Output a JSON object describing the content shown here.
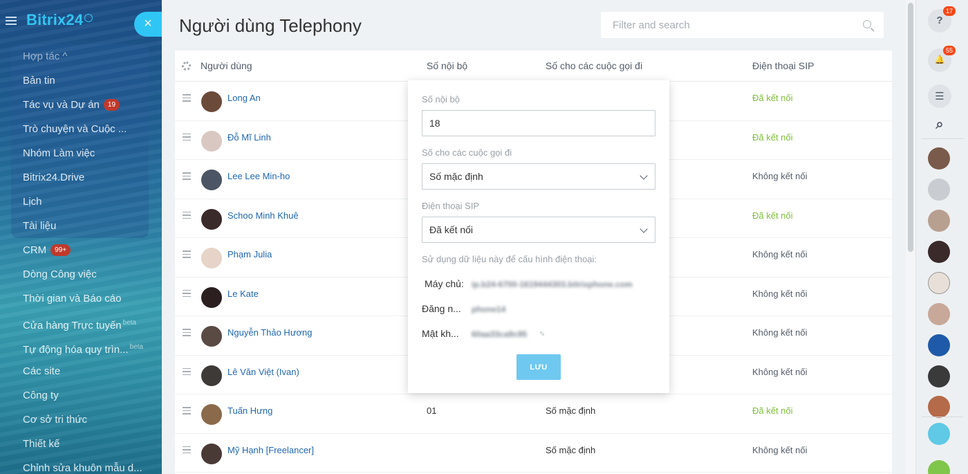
{
  "app": {
    "logo_text": "Bitrix24",
    "collapse_label": "×"
  },
  "sidebar": {
    "items": [
      {
        "label": "Hợp tác ^",
        "badge": "",
        "beta": ""
      },
      {
        "label": "Bản tin",
        "badge": "",
        "beta": ""
      },
      {
        "label": "Tác vụ và Dự án",
        "badge": "19",
        "beta": ""
      },
      {
        "label": "Trò chuyện và Cuộc ...",
        "badge": "",
        "beta": ""
      },
      {
        "label": "Nhóm Làm việc",
        "badge": "",
        "beta": ""
      },
      {
        "label": "Bitrix24.Drive",
        "badge": "",
        "beta": ""
      },
      {
        "label": "Lịch",
        "badge": "",
        "beta": ""
      },
      {
        "label": "Tài liệu",
        "badge": "",
        "beta": ""
      },
      {
        "label": "CRM",
        "badge": "99+",
        "beta": ""
      },
      {
        "label": "Dòng Công việc",
        "badge": "",
        "beta": ""
      },
      {
        "label": "Thời gian và Báo cáo",
        "badge": "",
        "beta": ""
      },
      {
        "label": "Cửa hàng Trực tuyến",
        "badge": "",
        "beta": "beta"
      },
      {
        "label": "Tự động hóa quy trìn...",
        "badge": "",
        "beta": "beta"
      },
      {
        "label": "Các site",
        "badge": "",
        "beta": ""
      },
      {
        "label": "Công ty",
        "badge": "",
        "beta": ""
      },
      {
        "label": "Cơ sở tri thức",
        "badge": "",
        "beta": ""
      },
      {
        "label": "Thiết kế",
        "badge": "",
        "beta": ""
      },
      {
        "label": "Chỉnh sửa khuôn mẫu d...",
        "badge": "",
        "beta": ""
      }
    ]
  },
  "main": {
    "title": "Người dùng Telephony",
    "search_placeholder": "Filter and search",
    "columns": {
      "user": "Người dùng",
      "ext": "Số nội bộ",
      "outgoing": "Số cho các cuộc gọi đi",
      "sip": "Điện thoại SIP"
    },
    "rows": [
      {
        "name": "Long An",
        "ext": "",
        "outgoing": "",
        "sip": "Đã kết nối",
        "connected": true,
        "avatar_color": "#6b4a3a"
      },
      {
        "name": "Đỗ Mĩ Linh",
        "ext": "",
        "outgoing": "",
        "sip": "Đã kết nối",
        "connected": true,
        "avatar_color": "#d9c8c2"
      },
      {
        "name": "Lee Lee Min-ho",
        "ext": "",
        "outgoing": "",
        "sip": "Không kết nối",
        "connected": false,
        "avatar_color": "#4b5563"
      },
      {
        "name": "Schoo Minh Khuê",
        "ext": "",
        "outgoing": "",
        "sip": "Đã kết nối",
        "connected": true,
        "avatar_color": "#3b2a2a"
      },
      {
        "name": "Phạm Julia",
        "ext": "",
        "outgoing": "",
        "sip": "Không kết nối",
        "connected": false,
        "avatar_color": "#e6d4c8"
      },
      {
        "name": "Le Kate",
        "ext": "",
        "outgoing": "",
        "sip": "Không kết nối",
        "connected": false,
        "avatar_color": "#2b1f1f"
      },
      {
        "name": "Nguyễn Thảo Hương",
        "ext": "",
        "outgoing": "",
        "sip": "Không kết nối",
        "connected": false,
        "avatar_color": "#5a4a44"
      },
      {
        "name": "Lê Văn Việt (Ivan)",
        "ext": "",
        "outgoing": "",
        "sip": "Không kết nối",
        "connected": false,
        "avatar_color": "#3e3a38"
      },
      {
        "name": "Tuấn Hưng",
        "ext": "01",
        "outgoing": "Số mặc định",
        "sip": "Đã kết nối",
        "connected": true,
        "avatar_color": "#8a6a4a"
      },
      {
        "name": "Mỹ Hạnh [Freelancer]",
        "ext": "",
        "outgoing": "Số mặc định",
        "sip": "Không kết nối",
        "connected": false,
        "avatar_color": "#4a3a36"
      }
    ]
  },
  "popup": {
    "ext_label": "Số nội bộ",
    "ext_value": "18",
    "outgoing_label": "Số cho các cuộc gọi đi",
    "outgoing_value": "Số mặc định",
    "sip_label": "Điện thoại SIP",
    "sip_value": "Đã kết nối",
    "note": "Sử dụng dữ liệu này để cấu hình điện thoại:",
    "server_label": "Máy chủ:",
    "server_value": "ip.b24-6700-1619444303.bitrixphone.com",
    "login_label": "Đăng n...",
    "login_value": "phone14",
    "password_label": "Mật kh...",
    "password_value": "60aa33ca9c95",
    "save_label": "LƯU"
  },
  "rightbar": {
    "help_badge": "17",
    "notify_badge": "55",
    "help_glyph": "?",
    "notify_glyph": "🔔",
    "chat_glyph": "☰",
    "search_glyph": "⌕"
  },
  "colors": {
    "accent": "#2fc6f6",
    "connected": "#7fbe38",
    "link": "#2067b0"
  }
}
